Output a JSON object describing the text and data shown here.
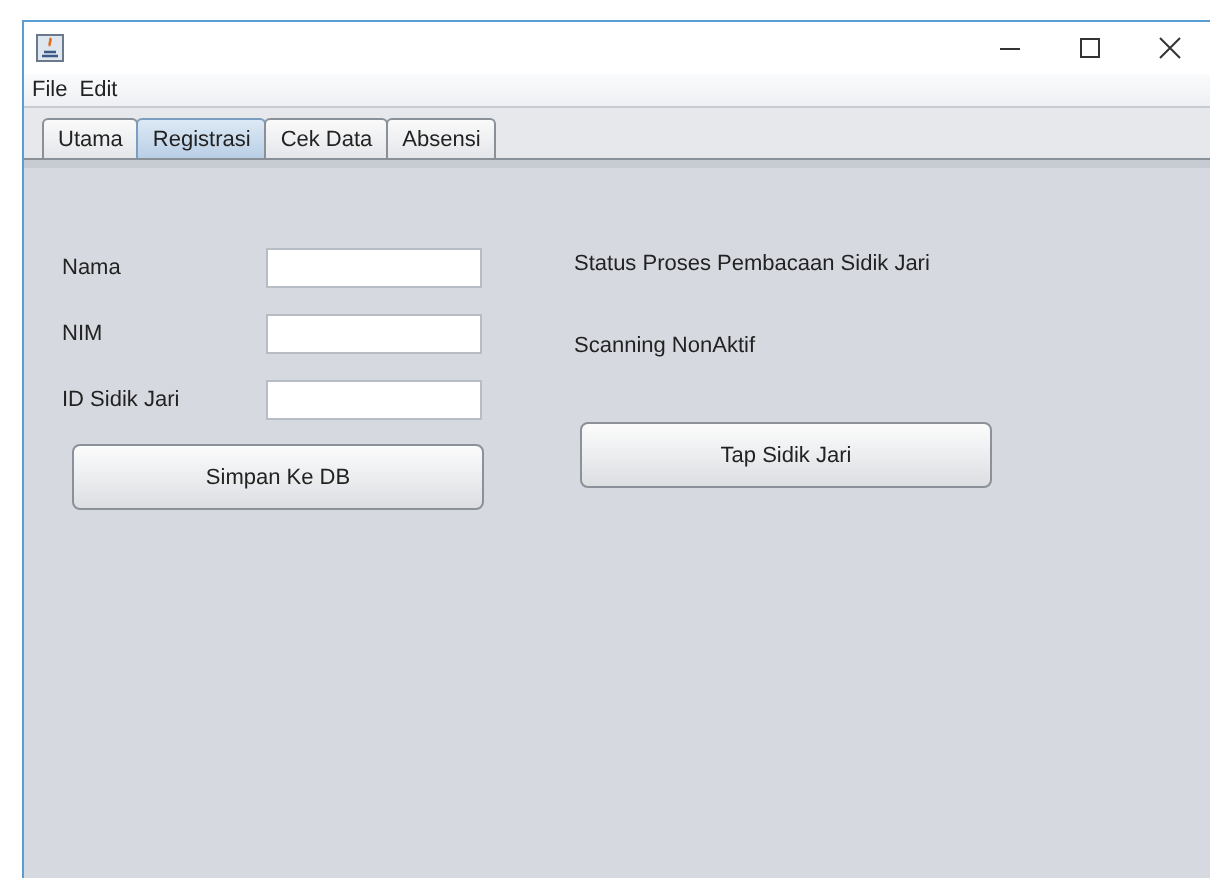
{
  "menu": [
    "File",
    "Edit"
  ],
  "tabs": [
    {
      "label": "Utama",
      "selected": false
    },
    {
      "label": "Registrasi",
      "selected": true
    },
    {
      "label": "Cek Data",
      "selected": false
    },
    {
      "label": "Absensi",
      "selected": false
    }
  ],
  "form": [
    {
      "label": "Nama"
    },
    {
      "label": "NIM"
    },
    {
      "label": "ID Sidik Jari"
    }
  ],
  "status_title": "Status Proses Pembacaan Sidik Jari",
  "status_value": "Scanning NonAktif",
  "buttons": [
    "Simpan Ke DB",
    "Tap Sidik Jari"
  ]
}
